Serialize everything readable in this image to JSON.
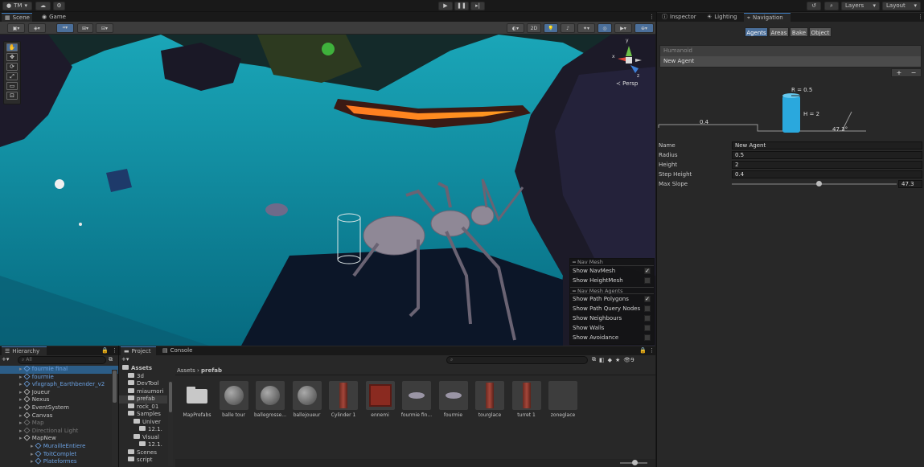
{
  "topbar": {
    "account": "TM",
    "layers": "Layers",
    "layout": "Layout"
  },
  "scene_tabs": [
    "Scene",
    "Game"
  ],
  "scene_toolbar": {
    "mode_2d": "2D"
  },
  "gizmo": {
    "axis_x": "x",
    "axis_y": "y",
    "axis_z": "z",
    "persp_label": "Persp"
  },
  "nav_overlay": {
    "header1": "Nav Mesh",
    "items1": [
      {
        "label": "Show NavMesh",
        "checked": "✓"
      },
      {
        "label": "Show HeightMesh",
        "checked": ""
      }
    ],
    "header2": "Nav Mesh Agents",
    "items2": [
      {
        "label": "Show Path Polygons",
        "checked": "✓"
      },
      {
        "label": "Show Path Query Nodes",
        "checked": ""
      },
      {
        "label": "Show Neighbours",
        "checked": ""
      },
      {
        "label": "Show Walls",
        "checked": ""
      },
      {
        "label": "Show Avoidance",
        "checked": ""
      }
    ]
  },
  "inspector": {
    "tabs": [
      "Inspector",
      "Lighting",
      "Navigation"
    ],
    "nav_buttons": [
      "Agents",
      "Areas",
      "Bake",
      "Object"
    ],
    "agent_list": [
      "Humanoid",
      "New Agent"
    ],
    "plus": "+",
    "minus": "−",
    "diagram": {
      "radius": "R = 0.5",
      "height": "H = 2",
      "step": "0.4",
      "slope": "47.3°"
    },
    "fields": [
      {
        "label": "Name",
        "value": "New Agent"
      },
      {
        "label": "Radius",
        "value": "0.5"
      },
      {
        "label": "Height",
        "value": "2"
      },
      {
        "label": "Step Height",
        "value": "0.4"
      }
    ],
    "max_slope": {
      "label": "Max Slope",
      "value": "47.3",
      "fraction": 0.525
    }
  },
  "hierarchy": {
    "title": "Hierarchy",
    "search_placeholder": "All",
    "items": [
      {
        "label": "fourmie final",
        "cls": "blue sel",
        "indent": 1
      },
      {
        "label": "fourmie",
        "cls": "blue",
        "indent": 1
      },
      {
        "label": "vfxgraph_Earthbender_v2",
        "cls": "blue",
        "indent": 1
      },
      {
        "label": "Joueur",
        "cls": "",
        "indent": 1
      },
      {
        "label": "Nexus",
        "cls": "",
        "indent": 1
      },
      {
        "label": "EventSystem",
        "cls": "",
        "indent": 1
      },
      {
        "label": "Canvas",
        "cls": "",
        "indent": 1
      },
      {
        "label": "Map",
        "cls": "grey",
        "indent": 1
      },
      {
        "label": "Directional Light",
        "cls": "grey",
        "indent": 1
      },
      {
        "label": "MapNew",
        "cls": "",
        "indent": 1
      },
      {
        "label": "MurailleEntiere",
        "cls": "blue",
        "indent": 2
      },
      {
        "label": "ToitComplet",
        "cls": "blue",
        "indent": 2
      },
      {
        "label": "Plateformes",
        "cls": "blue",
        "indent": 2
      }
    ]
  },
  "project": {
    "tabs": [
      "Project",
      "Console"
    ],
    "tree": [
      {
        "label": "Assets",
        "indent": 0,
        "bold": true
      },
      {
        "label": "3d",
        "indent": 1
      },
      {
        "label": "DevTool",
        "indent": 1
      },
      {
        "label": "miaumori",
        "indent": 1
      },
      {
        "label": "prefab",
        "indent": 1,
        "sel": true
      },
      {
        "label": "rock_01",
        "indent": 1
      },
      {
        "label": "Samples",
        "indent": 1
      },
      {
        "label": "Univer",
        "indent": 2
      },
      {
        "label": "12.1.",
        "indent": 3
      },
      {
        "label": "Visual",
        "indent": 2
      },
      {
        "label": "12.1.",
        "indent": 3
      },
      {
        "label": "Scenes",
        "indent": 1
      },
      {
        "label": "script",
        "indent": 1
      }
    ],
    "breadcrumb": [
      "Assets",
      "prefab"
    ],
    "hidden_count": "9",
    "assets": [
      {
        "label": "MapPrefabs",
        "kind": "folder"
      },
      {
        "label": "balle tour",
        "kind": "sphere"
      },
      {
        "label": "ballegrosse...",
        "kind": "sphere"
      },
      {
        "label": "ballejoueur",
        "kind": "sphere"
      },
      {
        "label": "Cylinder 1",
        "kind": "pillar"
      },
      {
        "label": "ennemi",
        "kind": "redcube"
      },
      {
        "label": "fourmie fin...",
        "kind": "ant"
      },
      {
        "label": "fourmie",
        "kind": "ant"
      },
      {
        "label": "tourglace",
        "kind": "pillar"
      },
      {
        "label": "turret 1",
        "kind": "pillar"
      },
      {
        "label": "zoneglace",
        "kind": "blank"
      }
    ]
  }
}
